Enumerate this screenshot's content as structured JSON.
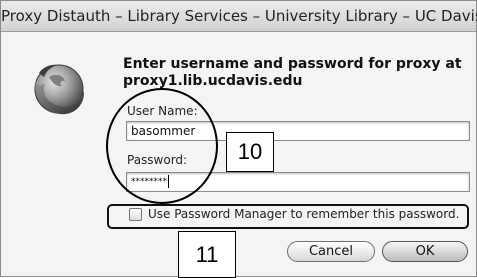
{
  "window": {
    "title": "Proxy Distauth – Library Services – University Library – UC Davis"
  },
  "icon": {
    "name": "firefox-icon"
  },
  "prompt": {
    "text": "Enter username and password for proxy at proxy1.lib.ucdavis.edu"
  },
  "form": {
    "username_label": "User Name:",
    "username_value": "basommer",
    "password_label": "Password:",
    "password_value": "********",
    "password_manager_label": "Use Password Manager to remember this password.",
    "password_manager_checked": false
  },
  "buttons": {
    "cancel_label": "Cancel",
    "ok_label": "OK"
  },
  "annotations": {
    "callout_1": "10",
    "callout_2": "11"
  }
}
